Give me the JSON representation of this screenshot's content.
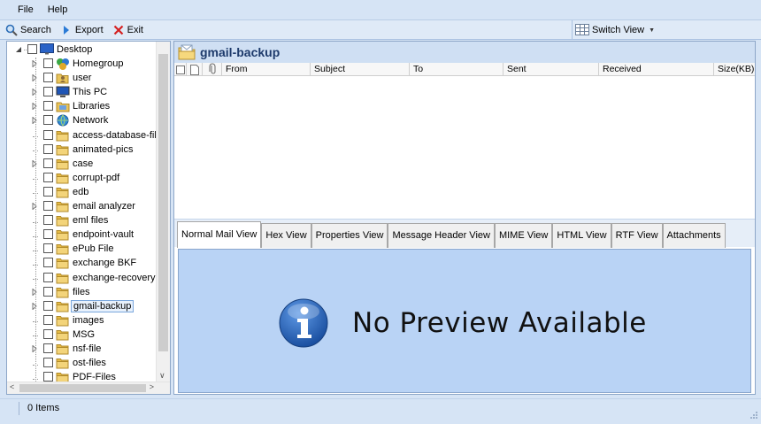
{
  "menu": {
    "file": "File",
    "help": "Help"
  },
  "toolbar": {
    "search": "Search",
    "export": "Export",
    "exit": "Exit",
    "switch_view": "Switch View"
  },
  "tree": {
    "items": [
      {
        "label": "Desktop",
        "icon": "desktop-icon",
        "level": 0,
        "expander": "open"
      },
      {
        "label": "Homegroup",
        "icon": "homegroup-icon",
        "level": 1,
        "expander": "closed"
      },
      {
        "label": "user",
        "icon": "user-folder-icon",
        "level": 1,
        "expander": "closed"
      },
      {
        "label": "This PC",
        "icon": "computer-icon",
        "level": 1,
        "expander": "closed"
      },
      {
        "label": "Libraries",
        "icon": "libraries-icon",
        "level": 1,
        "expander": "closed"
      },
      {
        "label": "Network",
        "icon": "network-icon",
        "level": 1,
        "expander": "closed"
      },
      {
        "label": "access-database-file",
        "icon": "folder-icon",
        "level": 1,
        "expander": "none"
      },
      {
        "label": "animated-pics",
        "icon": "folder-icon",
        "level": 1,
        "expander": "none"
      },
      {
        "label": "case",
        "icon": "folder-icon",
        "level": 1,
        "expander": "closed"
      },
      {
        "label": "corrupt-pdf",
        "icon": "folder-icon",
        "level": 1,
        "expander": "none"
      },
      {
        "label": "edb",
        "icon": "folder-icon",
        "level": 1,
        "expander": "none"
      },
      {
        "label": "email analyzer",
        "icon": "folder-icon",
        "level": 1,
        "expander": "closed"
      },
      {
        "label": "eml files",
        "icon": "folder-icon",
        "level": 1,
        "expander": "none"
      },
      {
        "label": "endpoint-vault",
        "icon": "folder-icon",
        "level": 1,
        "expander": "none"
      },
      {
        "label": "ePub File",
        "icon": "folder-icon",
        "level": 1,
        "expander": "none"
      },
      {
        "label": "exchange BKF",
        "icon": "folder-icon",
        "level": 1,
        "expander": "none"
      },
      {
        "label": "exchange-recovery",
        "icon": "folder-icon",
        "level": 1,
        "expander": "none"
      },
      {
        "label": "files",
        "icon": "folder-icon",
        "level": 1,
        "expander": "closed"
      },
      {
        "label": "gmail-backup",
        "icon": "folder-icon",
        "level": 1,
        "expander": "closed",
        "selected": true
      },
      {
        "label": "images",
        "icon": "folder-icon",
        "level": 1,
        "expander": "none"
      },
      {
        "label": "MSG",
        "icon": "folder-icon",
        "level": 1,
        "expander": "none"
      },
      {
        "label": "nsf-file",
        "icon": "folder-icon",
        "level": 1,
        "expander": "closed"
      },
      {
        "label": "ost-files",
        "icon": "folder-icon",
        "level": 1,
        "expander": "none"
      },
      {
        "label": "PDF-Files",
        "icon": "folder-icon",
        "level": 1,
        "expander": "none"
      }
    ]
  },
  "main": {
    "folder_title": "gmail-backup",
    "columns": [
      "From",
      "Subject",
      "To",
      "Sent",
      "Received",
      "Size(KB)"
    ],
    "tabs": [
      {
        "label": "Normal Mail View",
        "active": true
      },
      {
        "label": "Hex View"
      },
      {
        "label": "Properties View"
      },
      {
        "label": "Message Header View"
      },
      {
        "label": "MIME View"
      },
      {
        "label": "HTML View"
      },
      {
        "label": "RTF View"
      },
      {
        "label": "Attachments"
      }
    ],
    "preview_message": "No Preview Available"
  },
  "status": {
    "text": "0 Items"
  },
  "colors": {
    "chrome": "#d6e4f5",
    "header": "#cfdff3",
    "preview_bg": "#b9d3f5",
    "title_text": "#1d3a6b",
    "info_blue": "#1f5fb4",
    "folder_yellow": "#e9c45a"
  }
}
